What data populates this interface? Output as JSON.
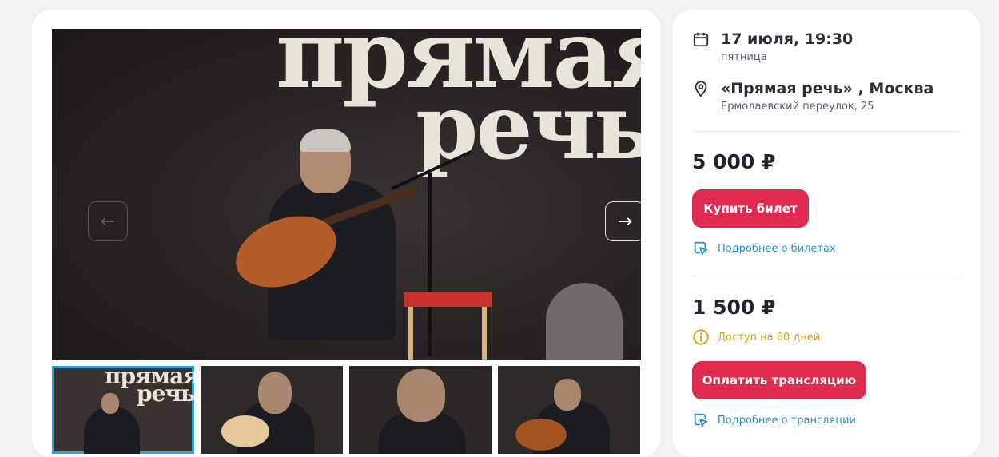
{
  "event": {
    "date": "17 июля, 19:30",
    "weekday": "пятница",
    "venue": "«Прямая речь» , Москва",
    "address": "Ермолаевский переулок, 25"
  },
  "photo": {
    "venue_sign_line1": "прямая",
    "venue_sign_line2": "речь",
    "prev_arrow": "←",
    "next_arrow": "→"
  },
  "thumbnails": [
    {
      "line1": "прямая",
      "line2": "речь",
      "active": true
    },
    {
      "line1": "",
      "line2": "",
      "active": false
    },
    {
      "line1": "",
      "line2": "",
      "active": false
    },
    {
      "line1": "",
      "line2": "",
      "active": false
    }
  ],
  "ticket": {
    "price": "5 000 ₽",
    "buy_label": "Купить билет",
    "more_label": "Подробнее о билетах"
  },
  "stream": {
    "price": "1 500 ₽",
    "access_label": "Доступ на 60 дней",
    "pay_label": "Оплатить трансляцию",
    "more_label": "Подробнее о трансляции"
  },
  "colors": {
    "accent": "#e0294f",
    "link": "#2a8fd1",
    "warning": "#e0a100",
    "thumb_active": "#2aa3e6"
  },
  "icons": {
    "date": "calendar-icon",
    "place": "location-pin-icon",
    "ticket_link": "cursor-click-icon",
    "access": "info-icon",
    "stream_link": "cursor-click-icon",
    "prev": "arrow-left-icon",
    "next": "arrow-right-icon"
  }
}
